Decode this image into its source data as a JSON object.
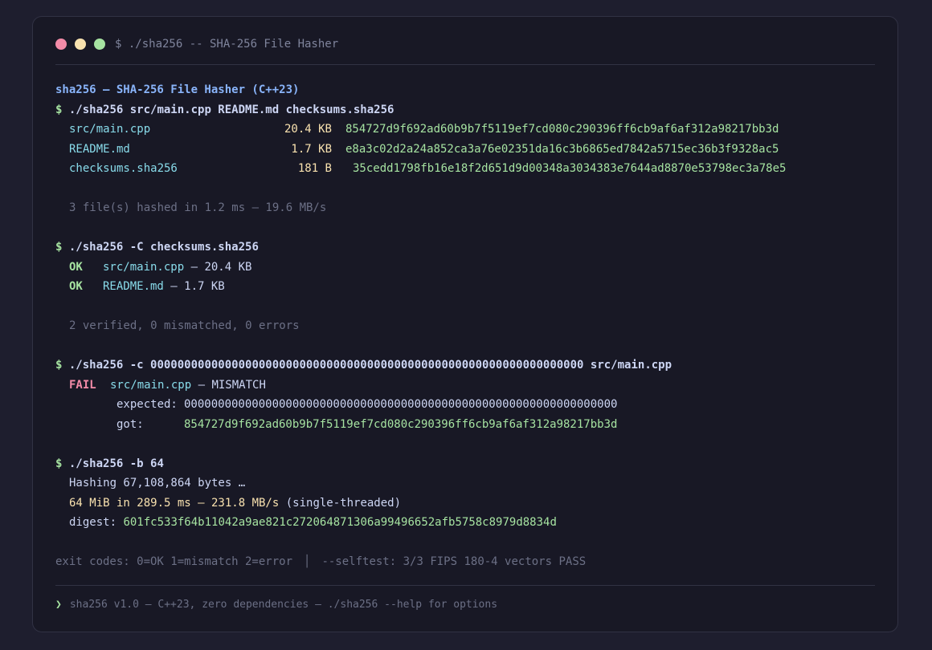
{
  "window": {
    "title": "$ ./sha256 -- SHA-256 File Hasher"
  },
  "header": "sha256 — SHA-256 File Hasher (C++23)",
  "prompt_symbol": "$",
  "cmd1": {
    "command": "./sha256 src/main.cpp README.md checksums.sha256",
    "rows": [
      {
        "file": "src/main.cpp",
        "size": "20.4 KB",
        "hash": "854727d9f692ad60b9b7f5119ef7cd080c290396ff6cb9af6af312a98217bb3d"
      },
      {
        "file": "README.md",
        "size": "1.7 KB",
        "hash": "e8a3c02d2a24a852ca3a76e02351da16c3b6865ed7842a5715ec36b3f9328ac5"
      },
      {
        "file": "checksums.sha256",
        "size": "181 B",
        "hash": "35cedd1798fb16e18f2d651d9d00348a3034383e7644ad8870e53798ec3a78e5"
      }
    ],
    "summary": "3 file(s) hashed in 1.2 ms — 19.6 MB/s"
  },
  "cmd2": {
    "command": "./sha256 -C checksums.sha256",
    "rows": [
      {
        "status": "OK",
        "file": "src/main.cpp",
        "rest": " — 20.4 KB"
      },
      {
        "status": "OK",
        "file": "README.md",
        "rest": " — 1.7 KB"
      }
    ],
    "summary": "2 verified, 0 mismatched, 0 errors"
  },
  "cmd3": {
    "command": "./sha256 -c 0000000000000000000000000000000000000000000000000000000000000000 src/main.cpp",
    "status": "FAIL",
    "file": "src/main.cpp",
    "rest": " — MISMATCH",
    "expected_label": "expected:",
    "expected_value": "0000000000000000000000000000000000000000000000000000000000000000",
    "got_label": "got:",
    "got_value": "854727d9f692ad60b9b7f5119ef7cd080c290396ff6cb9af6af312a98217bb3d"
  },
  "cmd4": {
    "command": "./sha256 -b 64",
    "hashing": "Hashing 67,108,864 bytes …",
    "result": "64 MiB in 289.5 ms — 231.8 MB/s",
    "result_note": " (single-threaded)",
    "digest_label": "digest:",
    "digest_value": "601fc533f64b11042a9ae821c272064871306a99496652afb5758c8979d8834d"
  },
  "status_line": {
    "exit_codes": "exit codes: 0=OK 1=mismatch 2=error",
    "separator": "│",
    "selftest": "--selftest: 3/3 FIPS 180-4 vectors PASS"
  },
  "footer": {
    "chevron": "❯",
    "text": "sha256 v1.0 — C++23, zero dependencies — ./sha256 --help for options"
  },
  "colors": {
    "background": "#1e1e2e",
    "panel": "#181825",
    "prompt": "#a6e3a1",
    "file": "#89dceb",
    "size": "#f9e2af",
    "hash": "#a6e3a1",
    "fail": "#f38ba8",
    "header": "#89b4fa",
    "dim": "#6c7086"
  }
}
